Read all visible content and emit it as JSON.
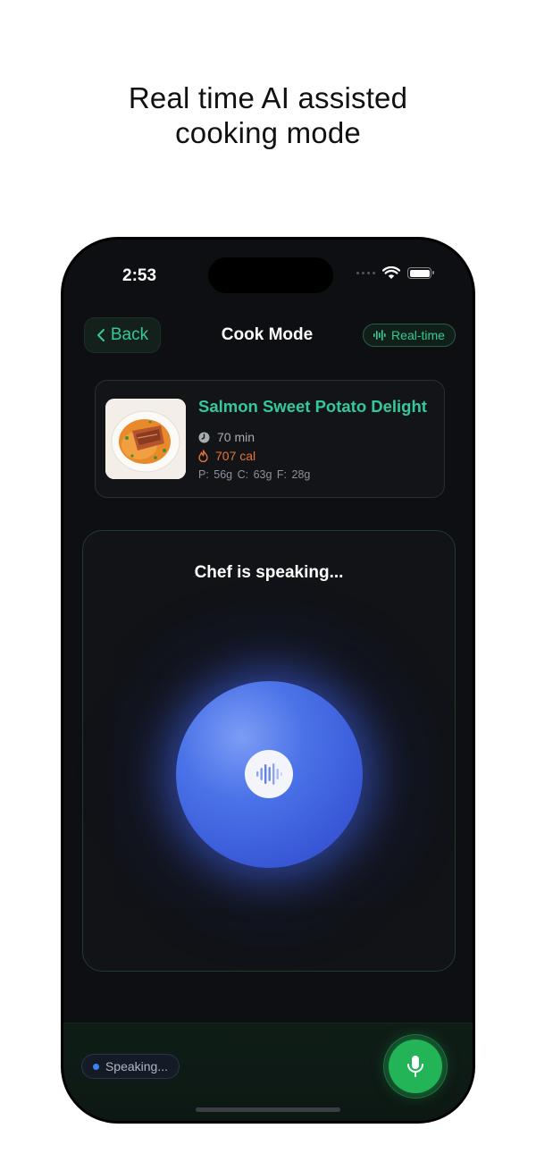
{
  "headline": {
    "line1": "Real time AI assisted",
    "line2": "cooking mode"
  },
  "status_bar": {
    "time": "2:53",
    "icons": [
      "cellular-icon",
      "wifi-icon",
      "battery-icon"
    ]
  },
  "nav": {
    "back_label": "Back",
    "title": "Cook Mode",
    "realtime_label": "Real-time"
  },
  "recipe": {
    "title": "Salmon Sweet Potato Delight",
    "time": "70 min",
    "calories": "707 cal",
    "macros": "P: 56g  C: 63g  F: 28g"
  },
  "voice": {
    "status": "Chef is speaking..."
  },
  "bottom_bar": {
    "speaking_label": "Speaking..."
  },
  "colors": {
    "accent_green": "#34c99a",
    "calorie_orange": "#e8743b",
    "orb_blue": "#4b73e8",
    "mic_green": "#23b457",
    "screen_bg": "#0e0f13"
  }
}
